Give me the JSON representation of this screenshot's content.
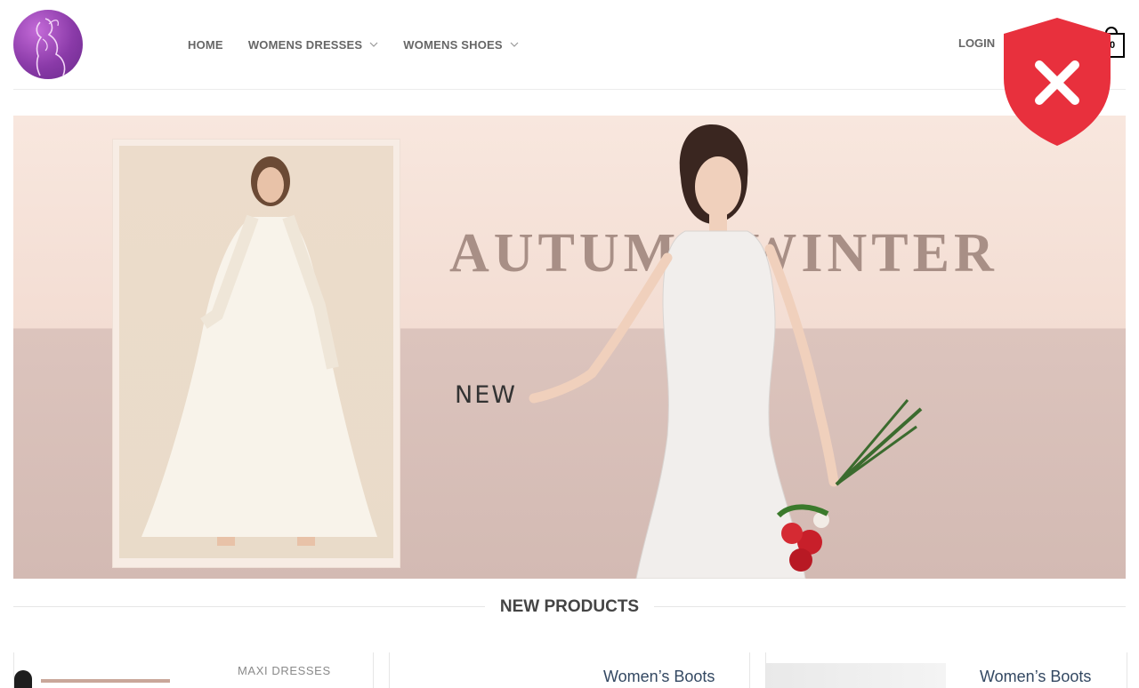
{
  "header": {
    "nav": [
      {
        "label": "HOME",
        "has_dropdown": false
      },
      {
        "label": "WOMENS DRESSES",
        "has_dropdown": true
      },
      {
        "label": "WOMENS SHOES",
        "has_dropdown": true
      }
    ],
    "login_label": "LOGIN",
    "cart_count": "0"
  },
  "banner": {
    "headline": "AUTUMN WINTER",
    "tag": "NEW"
  },
  "section": {
    "title": "NEW PRODUCTS"
  },
  "products": [
    {
      "category": "MAXI DRESSES",
      "name": ""
    },
    {
      "category": "",
      "name": "Women’s Boots"
    },
    {
      "category": "",
      "name": "Women’s Boots"
    }
  ],
  "colors": {
    "logo_purple": "#8a3aa8",
    "shield_red": "#e8303d",
    "title_taupe": "#a88f86",
    "product_link": "#334862"
  }
}
